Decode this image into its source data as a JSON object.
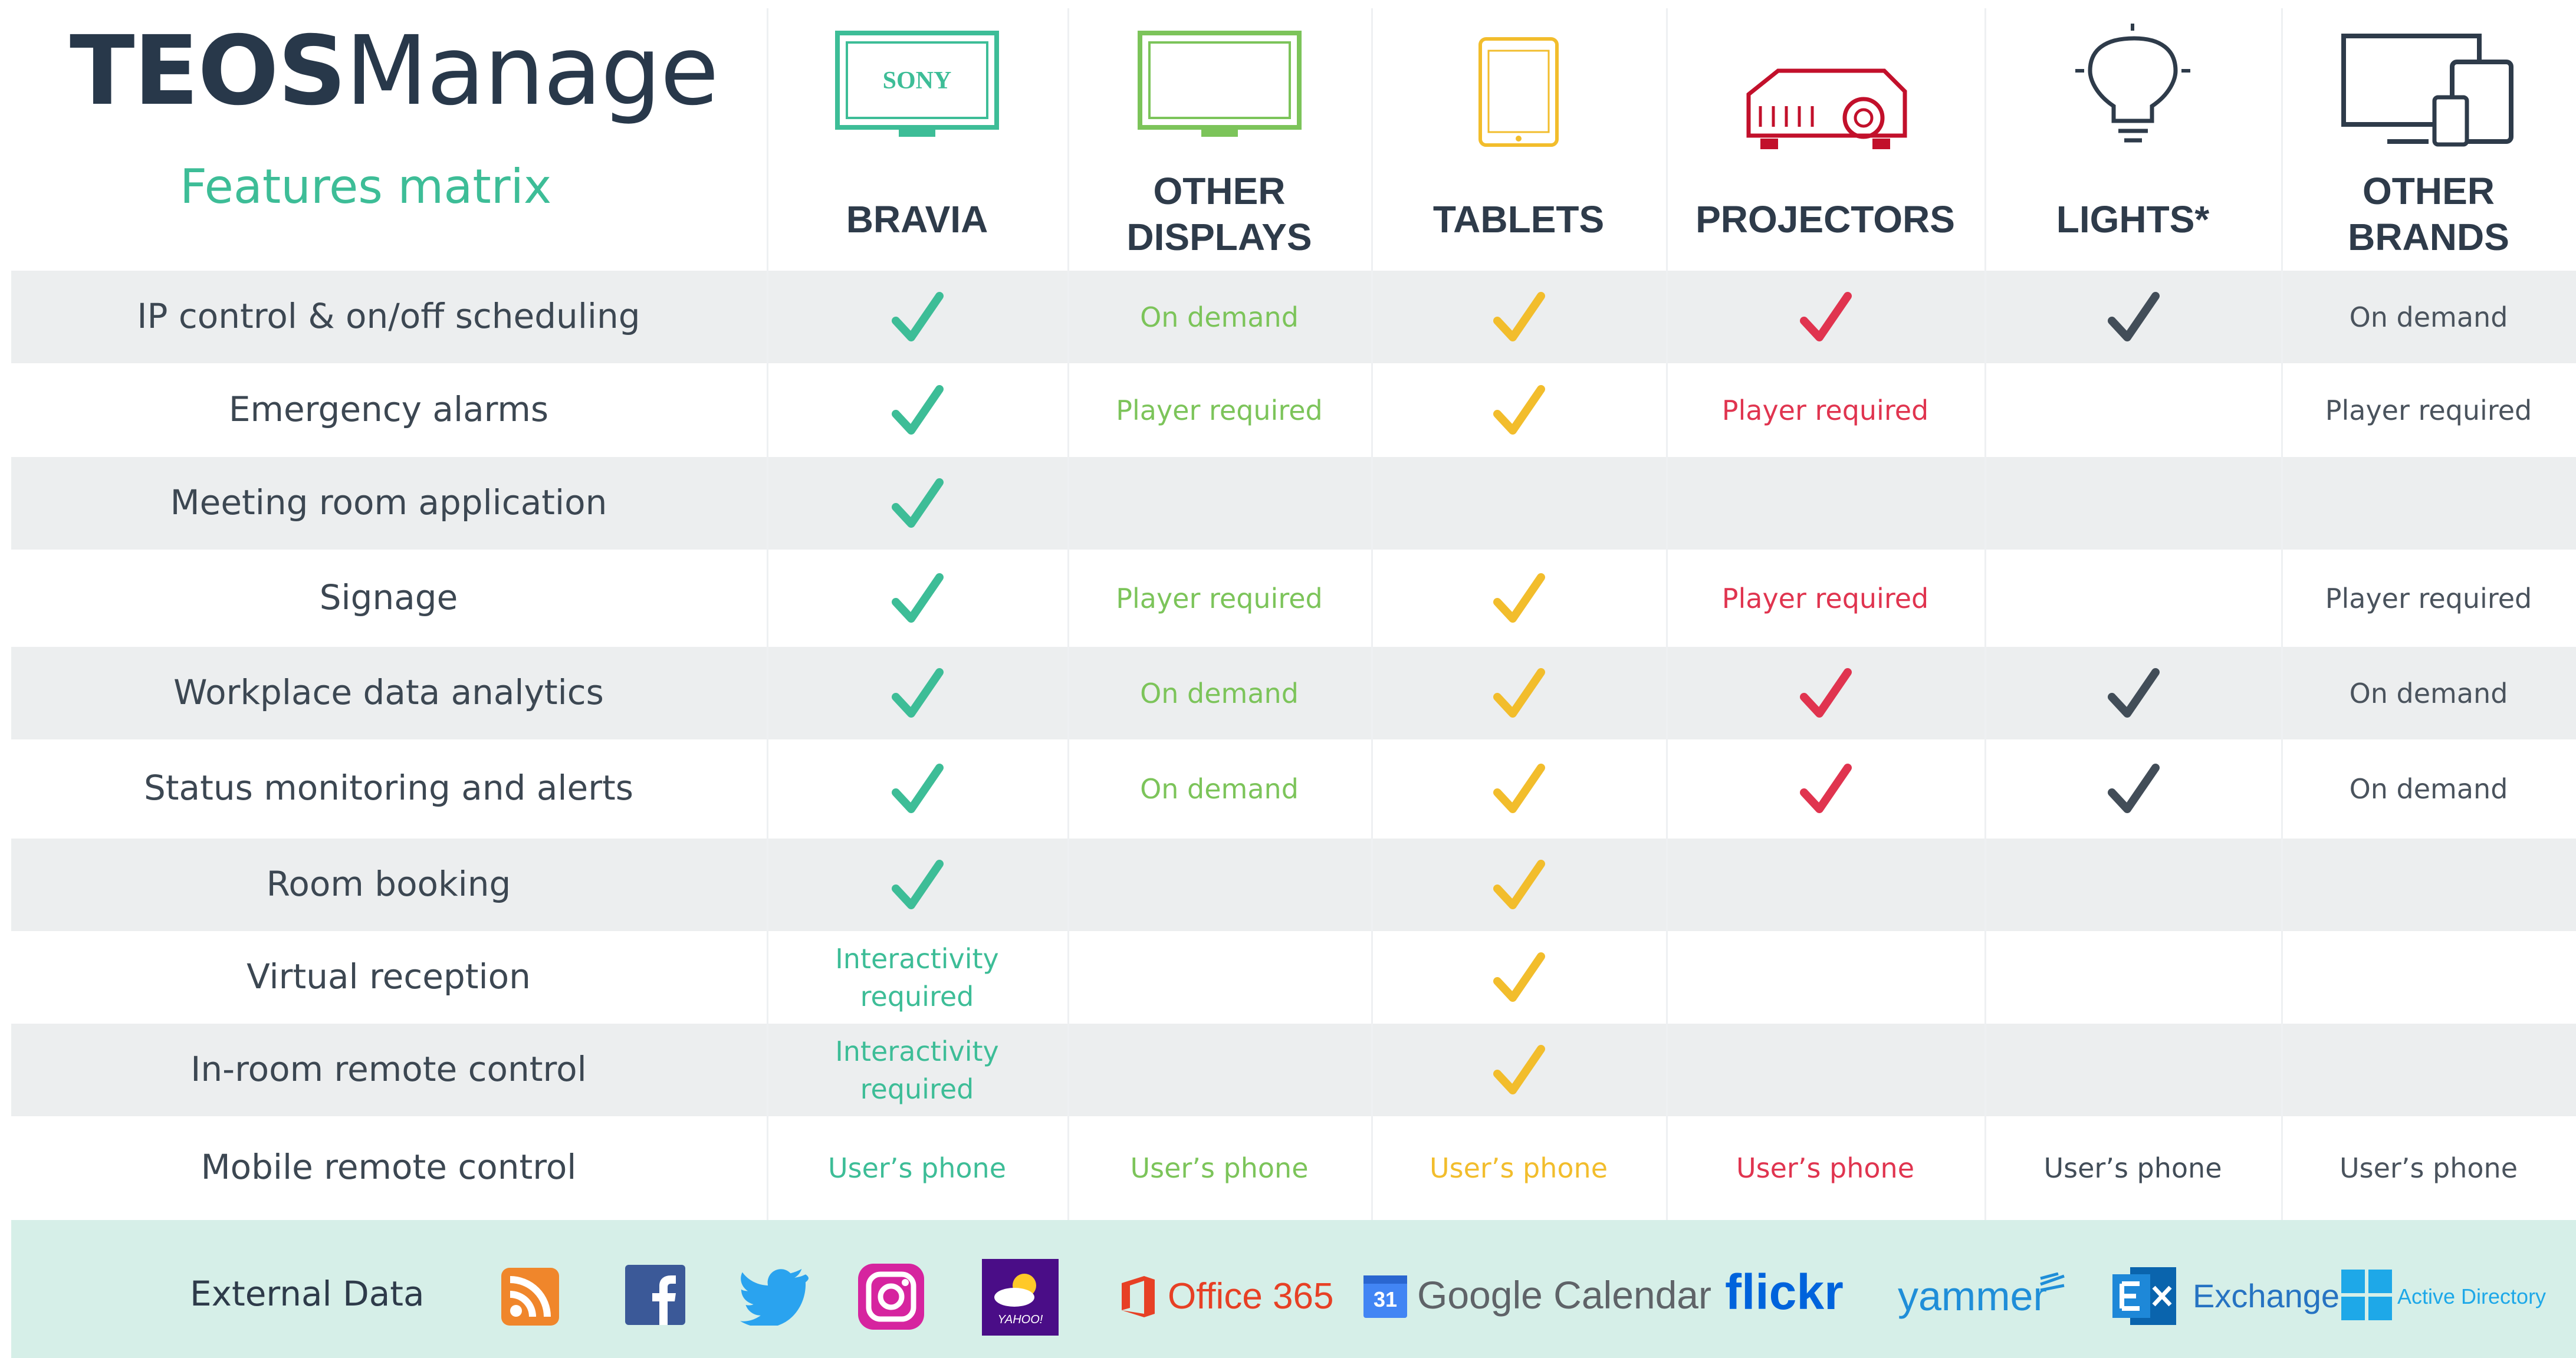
{
  "header": {
    "brand_bold": "TEOS",
    "brand_light": "Manage",
    "subtitle": "Features matrix"
  },
  "columns": [
    {
      "line1": "BRAVIA",
      "line2": "",
      "icon": "sony-tv-icon",
      "icon_label": "SONY"
    },
    {
      "line1": "OTHER",
      "line2": "DISPLAYS",
      "icon": "display-icon"
    },
    {
      "line1": "TABLETS",
      "line2": "",
      "icon": "tablet-icon"
    },
    {
      "line1": "PROJECTORS",
      "line2": "",
      "icon": "projector-icon"
    },
    {
      "line1": "LIGHTS*",
      "line2": "",
      "icon": "lightbulb-icon"
    },
    {
      "line1": "OTHER",
      "line2": "BRANDS",
      "icon": "devices-icon"
    }
  ],
  "column_colors": [
    "#3dbd97",
    "#7cc45a",
    "#f2bd2c",
    "#e0344f",
    "#424d58",
    "#4a535d"
  ],
  "rows": [
    {
      "label": "IP control & on/off scheduling",
      "cells": [
        "check",
        "On demand",
        "check",
        "check",
        "check",
        "On demand"
      ]
    },
    {
      "label": "Emergency alarms",
      "cells": [
        "check",
        "Player required",
        "check",
        "Player required",
        "",
        "Player required"
      ]
    },
    {
      "label": "Meeting room application",
      "cells": [
        "check",
        "",
        "",
        "",
        "",
        ""
      ]
    },
    {
      "label": "Signage",
      "cells": [
        "check",
        "Player required",
        "check",
        "Player required",
        "",
        "Player required"
      ]
    },
    {
      "label": "Workplace data analytics",
      "cells": [
        "check",
        "On demand",
        "check",
        "check",
        "check",
        "On demand"
      ]
    },
    {
      "label": "Status monitoring and alerts",
      "cells": [
        "check",
        "On demand",
        "check",
        "check",
        "check",
        "On demand"
      ]
    },
    {
      "label": "Room booking",
      "cells": [
        "check",
        "",
        "check",
        "",
        "",
        ""
      ]
    },
    {
      "label": "Virtual reception",
      "cells": [
        "Interactivity\nrequired",
        "",
        "check",
        "",
        "",
        ""
      ]
    },
    {
      "label": "In-room remote control",
      "cells": [
        "Interactivity\nrequired",
        "",
        "check",
        "",
        "",
        ""
      ]
    },
    {
      "label": "Mobile remote control",
      "cells": [
        "User’s phone",
        "User’s phone",
        "User’s phone",
        "User’s phone",
        "User’s phone",
        "User’s phone"
      ]
    }
  ],
  "footer": {
    "label": "External Data",
    "sources": [
      {
        "name": "rss-icon"
      },
      {
        "name": "facebook-icon"
      },
      {
        "name": "twitter-icon"
      },
      {
        "name": "instagram-icon"
      },
      {
        "name": "yahoo-weather-icon",
        "text": "YAHOO!"
      },
      {
        "name": "office365-logo",
        "text": "Office 365"
      },
      {
        "name": "google-calendar-logo",
        "text": "Google Calendar",
        "badge": "31"
      },
      {
        "name": "flickr-logo",
        "text": "flickr"
      },
      {
        "name": "yammer-logo",
        "text": "yammer"
      },
      {
        "name": "exchange-logo",
        "text": "Exchange"
      },
      {
        "name": "active-directory-logo",
        "text": "Active Directory"
      }
    ]
  }
}
